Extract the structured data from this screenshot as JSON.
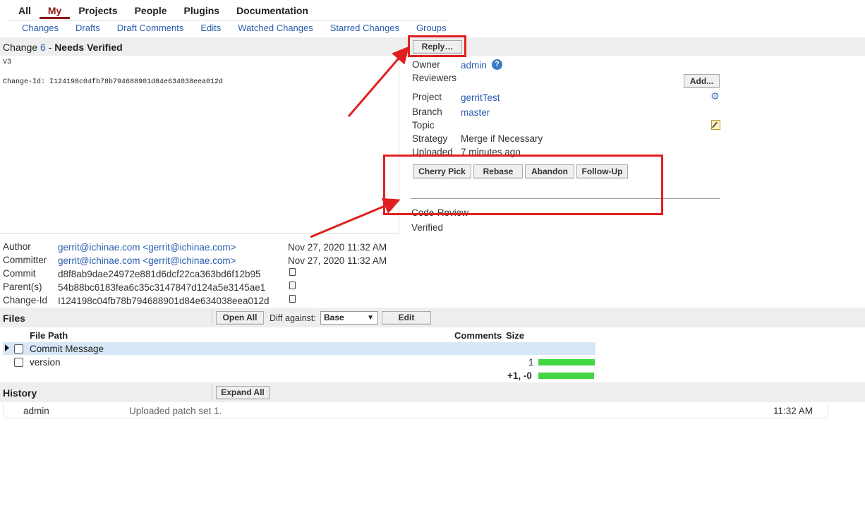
{
  "nav": {
    "top": [
      "All",
      "My",
      "Projects",
      "People",
      "Plugins",
      "Documentation"
    ],
    "active": "My",
    "sub": [
      "Changes",
      "Drafts",
      "Draft Comments",
      "Edits",
      "Watched Changes",
      "Starred Changes",
      "Groups"
    ]
  },
  "change": {
    "prefix": "Change",
    "number": "6",
    "separator": "-",
    "status": "Needs Verified",
    "reply_label": "Reply…",
    "message_line1": "V3",
    "message_line2": "Change-Id: I124198c04fb78b794688901d84e634038eea012d"
  },
  "info": {
    "owner_label": "Owner",
    "owner_value": "admin",
    "reviewers_label": "Reviewers",
    "add_label": "Add...",
    "project_label": "Project",
    "project_value": "gerritTest",
    "branch_label": "Branch",
    "branch_value": "master",
    "topic_label": "Topic",
    "strategy_label": "Strategy",
    "strategy_value": "Merge if Necessary",
    "uploaded_label": "Uploaded",
    "uploaded_value": "7 minutes ago",
    "actions": [
      "Cherry Pick",
      "Rebase",
      "Abandon",
      "Follow-Up"
    ],
    "labels": [
      "Code-Review",
      "Verified"
    ]
  },
  "commit": {
    "author_label": "Author",
    "author_value": "gerrit@ichinae.com <gerrit@ichinae.com>",
    "author_date": "Nov 27, 2020 11:32 AM",
    "committer_label": "Committer",
    "committer_value": "gerrit@ichinae.com <gerrit@ichinae.com>",
    "committer_date": "Nov 27, 2020 11:32 AM",
    "commit_label": "Commit",
    "commit_value": "d8f8ab9dae24972e881d6dcf22ca363bd6f12b95",
    "parent_label": "Parent(s)",
    "parent_value": "54b88bc6183fea6c35c3147847d124a5e3145ae1",
    "changeid_label": "Change-Id",
    "changeid_value": "I124198c04fb78b794688901d84e634038eea012d"
  },
  "files": {
    "title": "Files",
    "open_all": "Open All",
    "diff_against": "Diff against:",
    "diff_selected": "Base",
    "edit": "Edit",
    "col_path": "File Path",
    "col_comments": "Comments",
    "col_size": "Size",
    "rows": [
      {
        "path": "Commit Message",
        "size": ""
      },
      {
        "path": "version",
        "size": "1"
      }
    ],
    "total": "+1, -0"
  },
  "history": {
    "title": "History",
    "expand_all": "Expand All",
    "entry_user": "admin",
    "entry_text": "Uploaded patch set 1.",
    "entry_time": "11:32 AM"
  },
  "colors": {
    "annotation_red": "#e02020",
    "link_blue": "#2a5db0",
    "active_nav": "#8b1c1c",
    "size_bar": "#44d544"
  }
}
